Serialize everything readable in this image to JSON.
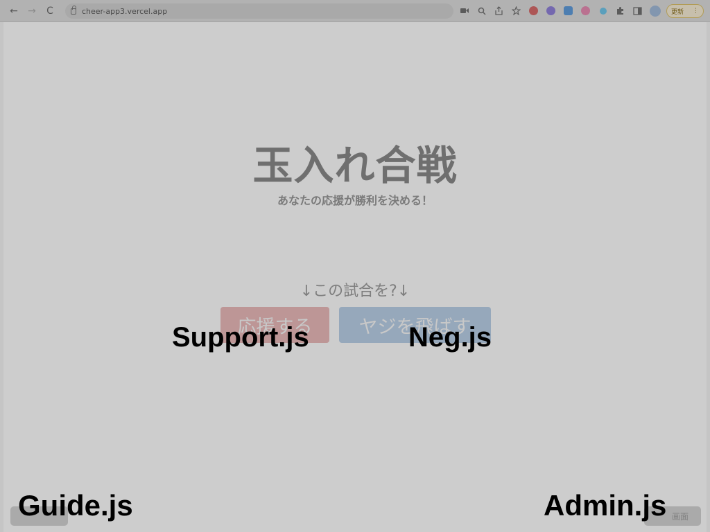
{
  "browser": {
    "url": "cheer-app3.vercel.app",
    "update_label": "更新",
    "menu_glyph": "⋮",
    "back_glyph": "←",
    "forward_glyph": "→",
    "reload_glyph": "C",
    "extension_colors": [
      "#d46a6a",
      "#8e7fd6",
      "#5e9ad8",
      "#e38ab0",
      "#6ec3e6"
    ]
  },
  "page": {
    "title": "玉入れ合戦",
    "subtitle": "あなたの応援が勝利を決める！",
    "question": "↓この試合を?↓",
    "support_button": "応援する",
    "neg_button": "ヤジを飛ばす",
    "left_corner_button": "",
    "right_corner_button": "画面"
  },
  "annotations": {
    "support": "Support.js",
    "neg": "Neg.js",
    "guide": "Guide.js",
    "admin": "Admin.js"
  },
  "colors": {
    "support": "#e7b7b8",
    "neg": "#b7cde5"
  }
}
